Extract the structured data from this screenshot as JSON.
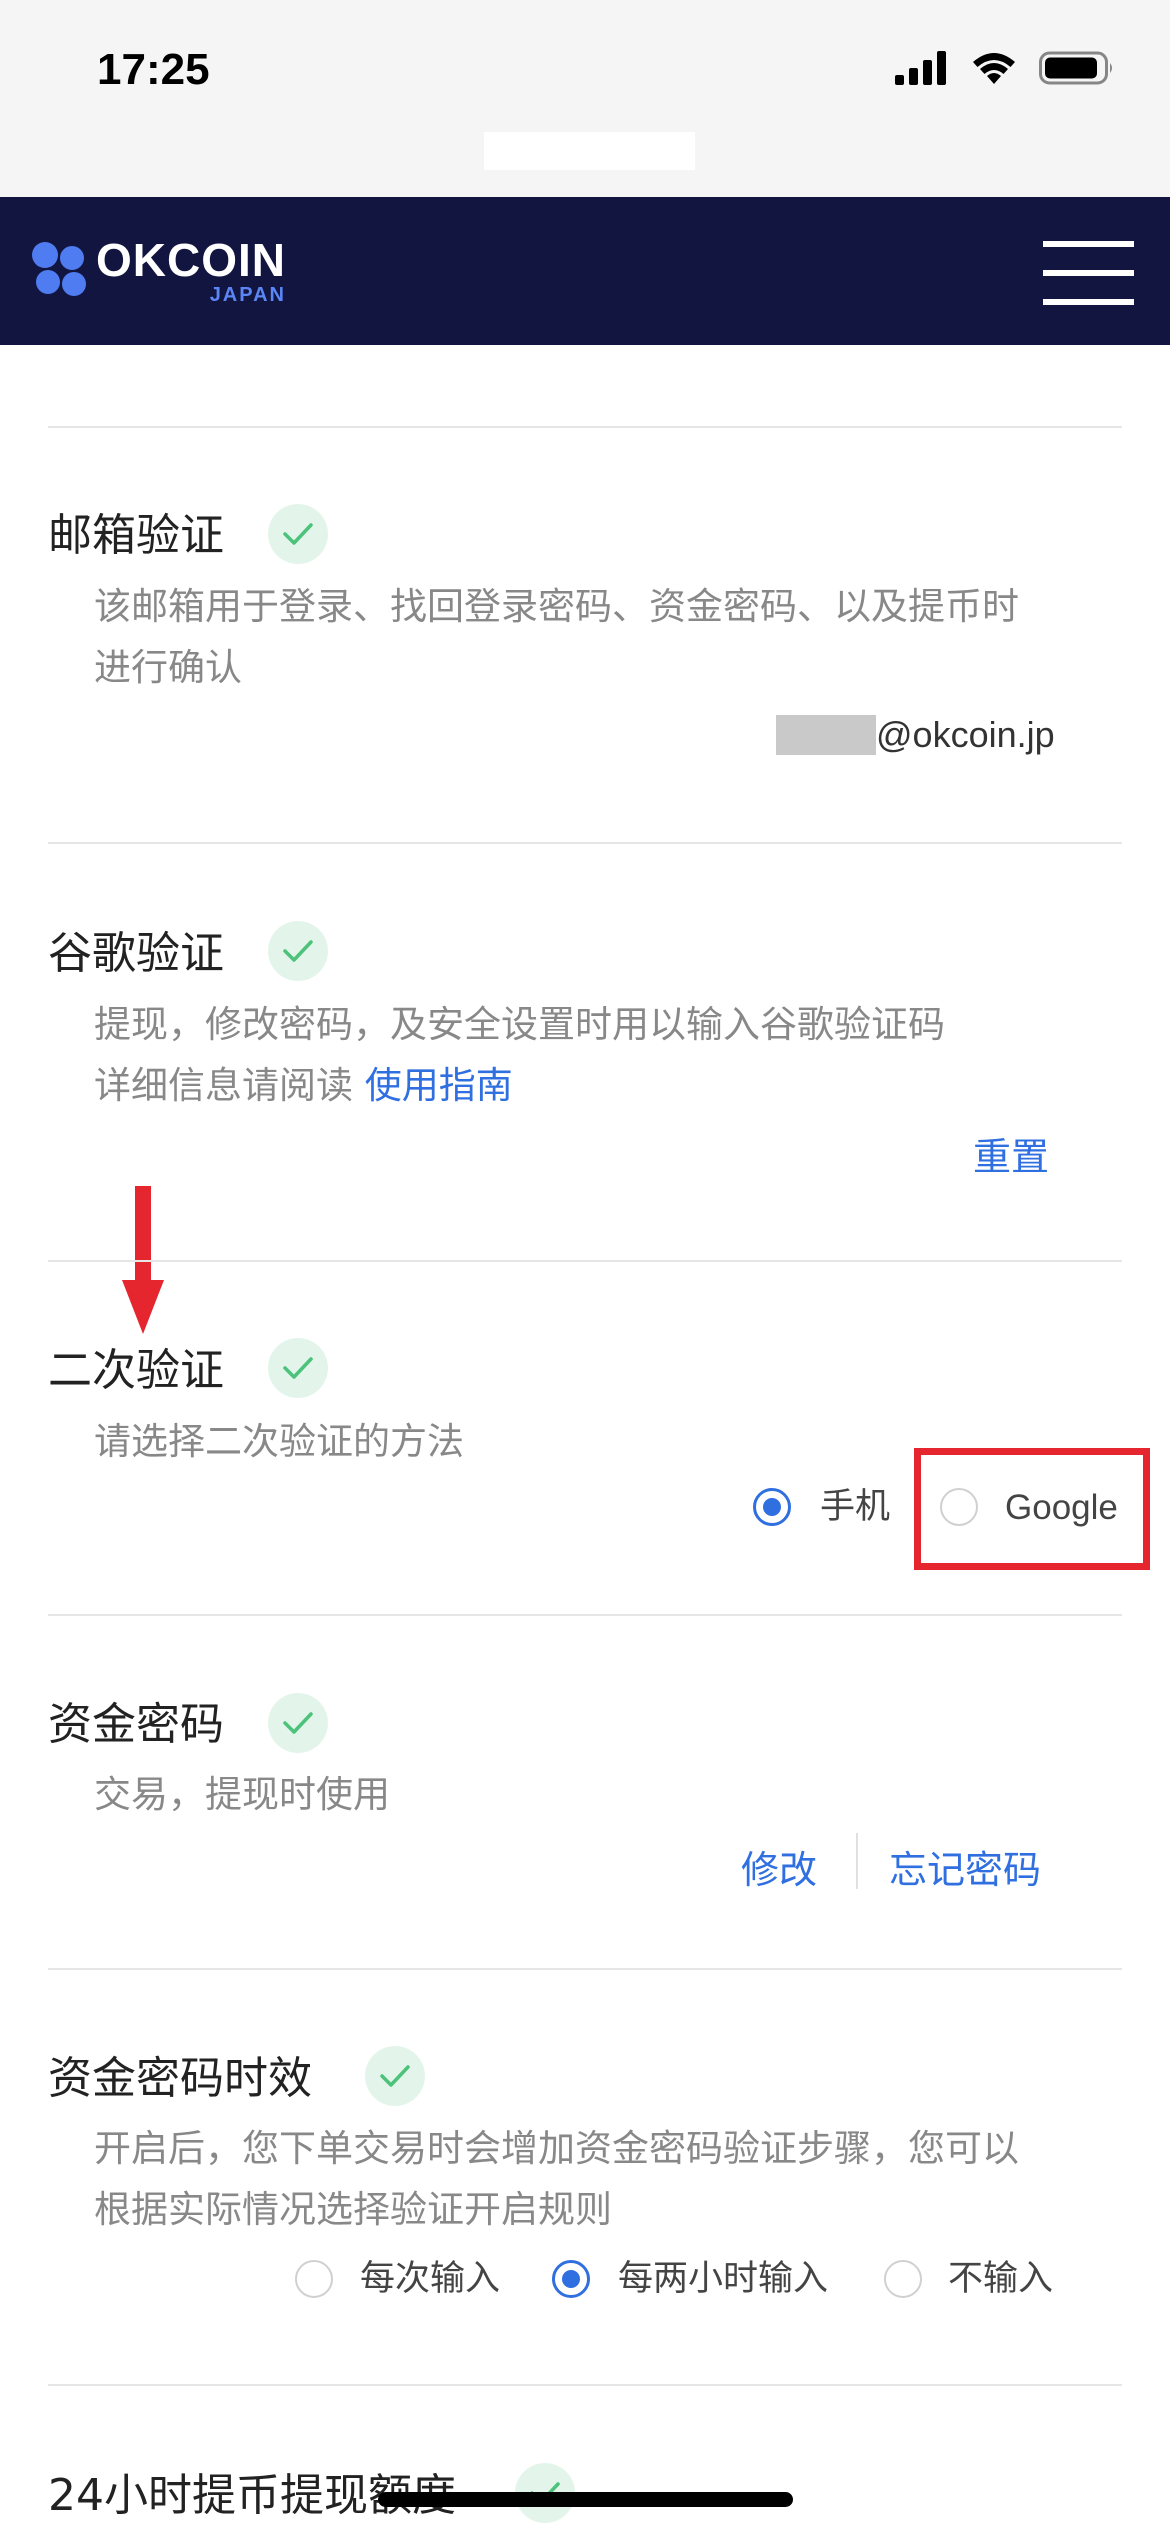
{
  "status_bar": {
    "time": "17:25"
  },
  "header": {
    "logo_main": "OKCOIN",
    "logo_sub": "JAPAN"
  },
  "sections": {
    "email": {
      "title": "邮箱验证",
      "desc_line1": "该邮箱用于登录、找回登录密码、资金密码、以及提币时",
      "desc_line2": "进行确认",
      "email_suffix": "@okcoin.jp"
    },
    "google": {
      "title": "谷歌验证",
      "desc_line1": "提现，修改密码，及安全设置时用以输入谷歌验证码",
      "desc_line2_prefix": "详细信息请阅读 ",
      "guide_link": "使用指南",
      "reset": "重置"
    },
    "second": {
      "title": "二次验证",
      "desc": "请选择二次验证的方法",
      "options": [
        {
          "label": "手机",
          "selected": true
        },
        {
          "label": "Google",
          "selected": false
        }
      ]
    },
    "fund": {
      "title": "资金密码",
      "desc": "交易，提现时使用",
      "modify": "修改",
      "forgot": "忘记密码"
    },
    "fund_validity": {
      "title": "资金密码时效",
      "desc_line1": "开启后，您下单交易时会增加资金密码验证步骤，您可以",
      "desc_line2": "根据实际情况选择验证开启规则",
      "options": [
        {
          "label": "每次输入",
          "selected": false
        },
        {
          "label": "每两小时输入",
          "selected": true
        },
        {
          "label": "不输入",
          "selected": false
        }
      ]
    },
    "limit": {
      "title": "24小时提币提现额度"
    }
  },
  "colors": {
    "navbar": "#121540",
    "accent": "#2f6fe0",
    "check_bg": "#e3f5ea",
    "check_mark": "#4cc27a",
    "annotation": "#e5262f"
  }
}
